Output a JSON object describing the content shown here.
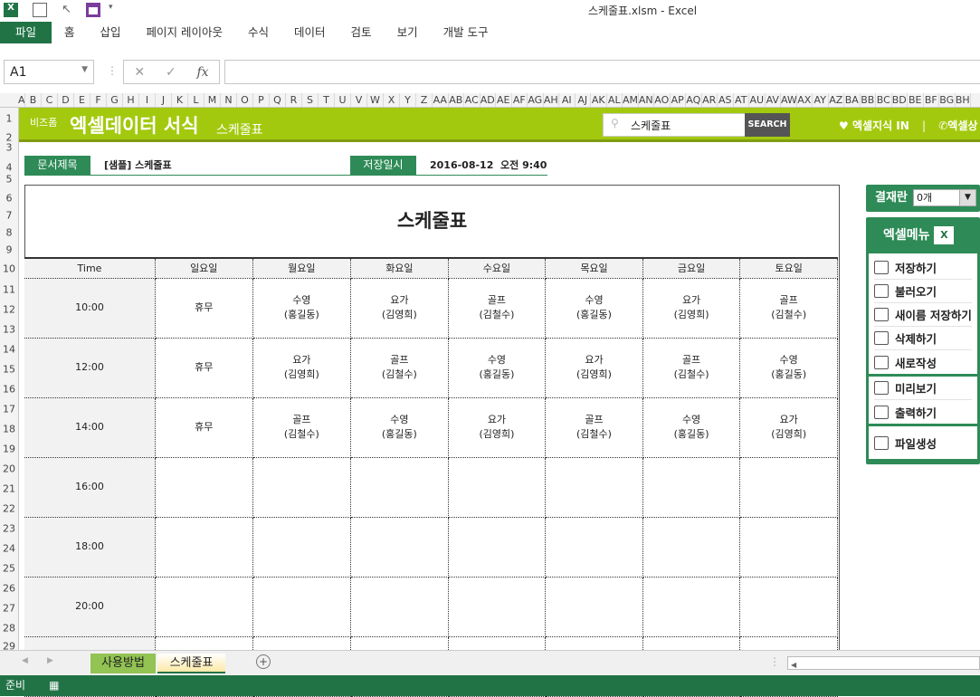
{
  "window": {
    "title": "스케줄표.xlsm - Excel"
  },
  "ribbon": {
    "tabs": [
      "파일",
      "홈",
      "삽입",
      "페이지 레이아웃",
      "수식",
      "데이터",
      "검토",
      "보기",
      "개발 도구"
    ]
  },
  "formula_bar": {
    "name_box": "A1",
    "formula": "",
    "fx": "fx"
  },
  "columns": [
    "A",
    "B",
    "C",
    "D",
    "E",
    "F",
    "G",
    "H",
    "I",
    "J",
    "K",
    "L",
    "M",
    "N",
    "O",
    "P",
    "Q",
    "R",
    "S",
    "T",
    "U",
    "V",
    "W",
    "X",
    "Y",
    "Z",
    "AA",
    "AB",
    "AC",
    "AD",
    "AE",
    "AF",
    "AG",
    "AH",
    "AI",
    "AJ",
    "AK",
    "AL",
    "AM",
    "AN",
    "AO",
    "AP",
    "AQ",
    "AR",
    "AS",
    "AT",
    "AU",
    "AV",
    "AW",
    "AX",
    "AY",
    "AZ",
    "BA",
    "BB",
    "BC",
    "BD",
    "BE",
    "BF",
    "BG",
    "BH"
  ],
  "rows": [
    "1",
    "2",
    "3",
    "4",
    "5",
    "6",
    "7",
    "8",
    "9",
    "10",
    "11",
    "12",
    "13",
    "14",
    "15",
    "16",
    "17",
    "18",
    "19",
    "20",
    "21",
    "22",
    "23",
    "24",
    "25",
    "26",
    "27",
    "28",
    "29"
  ],
  "banner": {
    "brand": "비즈폼",
    "title": "엑셀데이터 서식",
    "subtitle": "스케줄표",
    "search_value": "스케줄표",
    "search_button": "SEARCH",
    "link1": "엑셀지식 IN",
    "separator": "|",
    "link2": "엑셀상"
  },
  "info": {
    "doc_label": "문서제목",
    "doc_value": "[샘플] 스케줄표",
    "save_label": "저장일시",
    "save_value": "2016-08-12  오전 9:40"
  },
  "schedule": {
    "title": "스케줄표",
    "headers": [
      "Time",
      "일요일",
      "월요일",
      "화요일",
      "수요일",
      "목요일",
      "금요일",
      "토요일"
    ],
    "rows": [
      {
        "time": "10:00",
        "cells": [
          [
            "휴무",
            ""
          ],
          [
            "수영",
            "(홍길동)"
          ],
          [
            "요가",
            "(김영희)"
          ],
          [
            "골프",
            "(김철수)"
          ],
          [
            "수영",
            "(홍길동)"
          ],
          [
            "요가",
            "(김영희)"
          ],
          [
            "골프",
            "(김철수)"
          ]
        ]
      },
      {
        "time": "12:00",
        "cells": [
          [
            "휴무",
            ""
          ],
          [
            "요가",
            "(김영희)"
          ],
          [
            "골프",
            "(김철수)"
          ],
          [
            "수영",
            "(홍길동)"
          ],
          [
            "요가",
            "(김영희)"
          ],
          [
            "골프",
            "(김철수)"
          ],
          [
            "수영",
            "(홍길동)"
          ]
        ]
      },
      {
        "time": "14:00",
        "cells": [
          [
            "휴무",
            ""
          ],
          [
            "골프",
            "(김철수)"
          ],
          [
            "수영",
            "(홍길동)"
          ],
          [
            "요가",
            "(김영희)"
          ],
          [
            "골프",
            "(김철수)"
          ],
          [
            "수영",
            "(홍길동)"
          ],
          [
            "요가",
            "(김영희)"
          ]
        ]
      },
      {
        "time": "16:00",
        "cells": []
      },
      {
        "time": "18:00",
        "cells": []
      },
      {
        "time": "20:00",
        "cells": []
      },
      {
        "time": "",
        "cells": []
      }
    ]
  },
  "side": {
    "approval_label": "결재란",
    "approval_value": "0개",
    "menu_title": "엑셀메뉴",
    "groups": [
      [
        {
          "label": "저장하기",
          "icon": "save-icon"
        },
        {
          "label": "불러오기",
          "icon": "load-icon"
        },
        {
          "label": "새이름 저장하기",
          "icon": "save-as-icon"
        },
        {
          "label": "삭제하기",
          "icon": "trash-icon"
        },
        {
          "label": "새로작성",
          "icon": "new-doc-icon"
        }
      ],
      [
        {
          "label": "미리보기",
          "icon": "preview-icon"
        },
        {
          "label": "출력하기",
          "icon": "print-icon"
        }
      ],
      [
        {
          "label": "파일생성",
          "icon": "folder-icon"
        }
      ]
    ]
  },
  "sheets": [
    {
      "label": "사용방법",
      "color": "#92c353"
    },
    {
      "label": "스케줄표",
      "active": true
    }
  ],
  "status": {
    "text": "준비"
  },
  "colors": {
    "excel_green": "#217346",
    "banner": "#a3c90e",
    "accent": "#2e8b57"
  }
}
